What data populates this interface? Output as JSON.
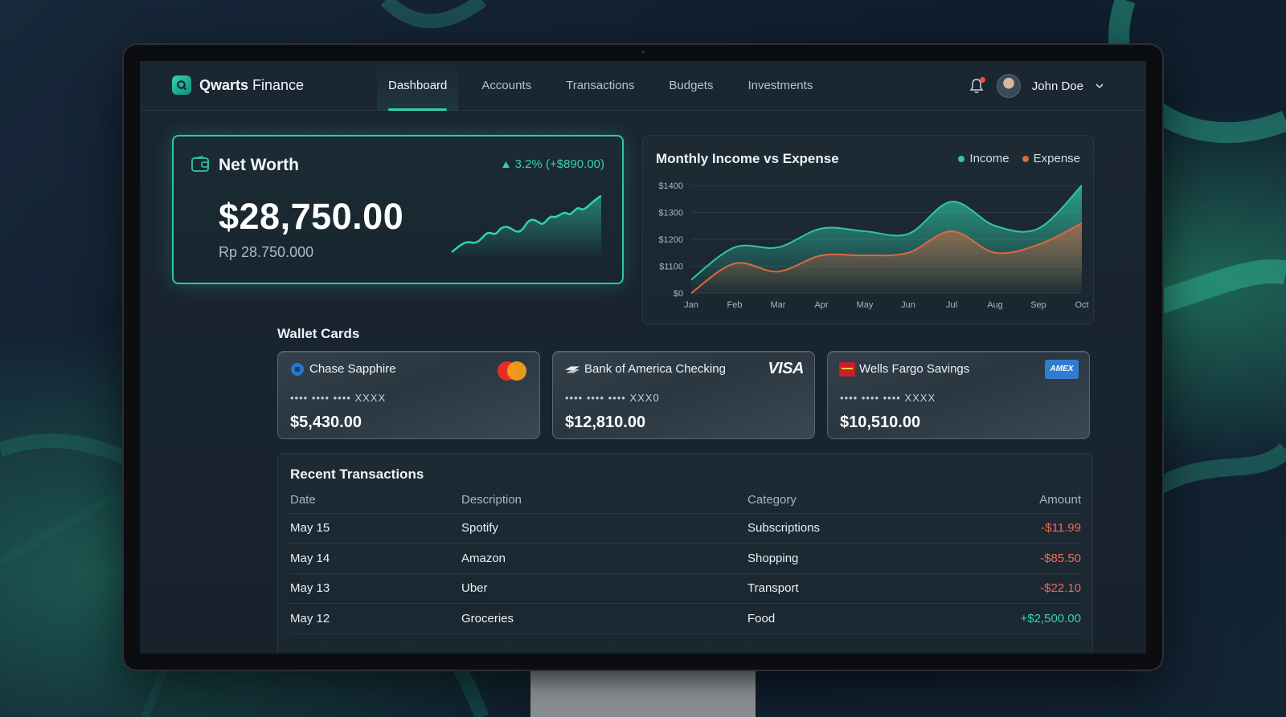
{
  "brand": {
    "name_bold": "Qwarts",
    "name_rest": " Finance"
  },
  "nav": {
    "links": [
      "Dashboard",
      "Accounts",
      "Transactions",
      "Budgets",
      "Investments"
    ],
    "active": "Dashboard"
  },
  "user": {
    "name": "John Doe",
    "has_notification": true
  },
  "net_worth": {
    "title": "Net Worth",
    "change": "3.2% (+$890.00)",
    "amount": "$28,750.00",
    "secondary": "Rp 28.750.000"
  },
  "income_chart": {
    "title": "Monthly Income vs Expense",
    "legend": {
      "income": "Income",
      "expense": "Expense"
    },
    "y_ticks": [
      "$1400",
      "$1300",
      "$1200",
      "$1100",
      "$0"
    ],
    "x_ticks": [
      "Jan",
      "Feb",
      "Mar",
      "Apr",
      "May",
      "Jun",
      "Jul",
      "Aug",
      "Sep",
      "Oct"
    ]
  },
  "chart_data": {
    "type": "area",
    "title": "Monthly Income vs Expense",
    "categories": [
      "Jan",
      "Feb",
      "Mar",
      "Apr",
      "May",
      "Jun",
      "Jul",
      "Aug",
      "Sep",
      "Oct"
    ],
    "yticks": [
      "$0",
      "$1100",
      "$1200",
      "$1300",
      "$1400"
    ],
    "series": [
      {
        "name": "Income",
        "color": "#2fc7a6",
        "values": [
          1050,
          1170,
          1170,
          1240,
          1230,
          1220,
          1340,
          1250,
          1240,
          1400
        ]
      },
      {
        "name": "Expense",
        "color": "#e0673f",
        "values": [
          1000,
          1110,
          1080,
          1140,
          1140,
          1150,
          1230,
          1150,
          1180,
          1260
        ]
      }
    ],
    "grid": true,
    "legend_position": "top-right"
  },
  "wallet": {
    "title": "Wallet Cards",
    "cards": [
      {
        "name": "Chase Sapphire",
        "number": "•••• •••• •••• XXXX",
        "balance": "$5,430.00",
        "network": "mastercard"
      },
      {
        "name": "Bank of America Checking",
        "number": "•••• •••• •••• XXX0",
        "balance": "$12,810.00",
        "network": "VISA"
      },
      {
        "name": "Wells Fargo Savings",
        "number": "•••• •••• •••• XXXX",
        "balance": "$10,510.00",
        "network": "AMEX"
      }
    ]
  },
  "transactions": {
    "title": "Recent Transactions",
    "headers": [
      "Date",
      "Description",
      "Category",
      "Amount"
    ],
    "rows": [
      {
        "date": "May 15",
        "description": "Spotify",
        "category": "Subscriptions",
        "amount": "-$11.99"
      },
      {
        "date": "May 14",
        "description": "Amazon",
        "category": "Shopping",
        "amount": "-$85.50"
      },
      {
        "date": "May 13",
        "description": "Uber",
        "category": "Transport",
        "amount": "-$22.10"
      },
      {
        "date": "May 12",
        "description": "Groceries",
        "category": "Food",
        "amount": "+$2,500.00"
      }
    ]
  },
  "colors": {
    "accent": "#2fc7a6",
    "expense": "#e0673f",
    "negative": "#ec6b5e",
    "positive": "#36d3ad"
  }
}
